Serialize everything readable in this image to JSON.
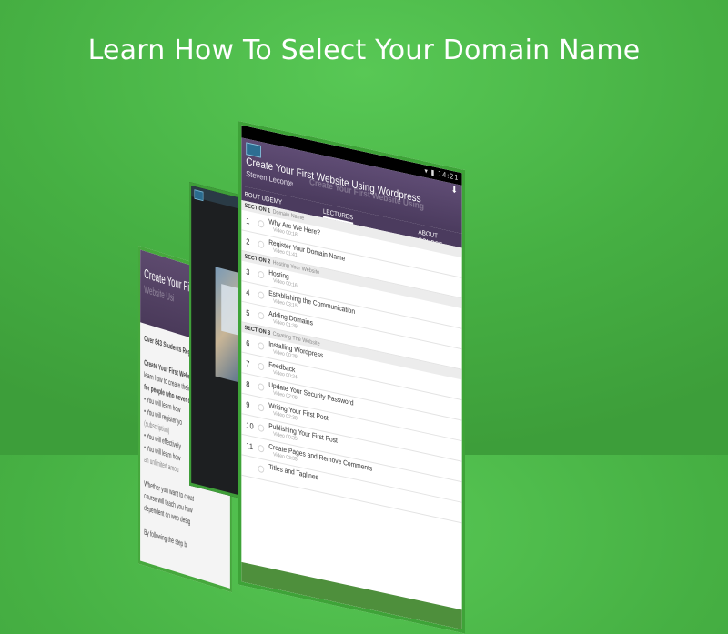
{
  "headline": "Learn How To Select Your Domain Name",
  "front": {
    "status_icons": "▾ ▮ 14:21",
    "download_icon": "download-icon",
    "title": "Create Your First Website Using Wordpress",
    "author": "Steven Leconte",
    "ghost_text": "Create Your First Website Using",
    "tabs": [
      "BOUT UDEMY",
      "LECTURES",
      "ABOUT COURSE"
    ],
    "sections": [
      {
        "label": "SECTION 1",
        "name": "Domain Name",
        "items": [
          {
            "num": "1",
            "title": "Why Are We Here?",
            "meta": "Video 00:18"
          },
          {
            "num": "2",
            "title": "Register Your Domain Name",
            "meta": "Video 01:41"
          }
        ]
      },
      {
        "label": "SECTION 2",
        "name": "Hosting Your Website",
        "items": [
          {
            "num": "3",
            "title": "Hosting",
            "meta": "Video 00:16"
          },
          {
            "num": "4",
            "title": "Establishing the Communication",
            "meta": "Video 03:15"
          },
          {
            "num": "5",
            "title": "Adding Domains",
            "meta": "Video 01:39"
          }
        ]
      },
      {
        "label": "SECTION 3",
        "name": "Creating The Website",
        "items": [
          {
            "num": "6",
            "title": "Installing Wordpress",
            "meta": "Video 00:39"
          },
          {
            "num": "7",
            "title": "Feedback",
            "meta": "Video 00:24"
          },
          {
            "num": "8",
            "title": "Update Your Security Password",
            "meta": "Video 02:09"
          },
          {
            "num": "9",
            "title": "Writing Your First Post",
            "meta": "Video 02:38"
          },
          {
            "num": "10",
            "title": "Publishing Your First Post",
            "meta": "Video 00:35"
          },
          {
            "num": "11",
            "title": "Create Pages and Remove Comments",
            "meta": "Video 03:35"
          },
          {
            "num": "",
            "title": "Titles and Taglines",
            "meta": ""
          }
        ]
      }
    ]
  },
  "back": {
    "title": "Create Your First",
    "subtitle": "Website Usi",
    "lines": [
      {
        "text": "Over 843 Students Registe",
        "style": "bold"
      },
      {
        "text": "",
        "style": ""
      },
      {
        "text": "Create Your First Website",
        "style": "bold"
      },
      {
        "text": "learn how to create their",
        "style": ""
      },
      {
        "text": "for people who never crea",
        "style": "bold"
      },
      {
        "text": "• You will learn how",
        "style": ""
      },
      {
        "text": "• You will register yo",
        "style": ""
      },
      {
        "text": "  (subscription)",
        "style": "dim"
      },
      {
        "text": "• You will effectively",
        "style": ""
      },
      {
        "text": "• You will learn how",
        "style": ""
      },
      {
        "text": "  an unlimited amou",
        "style": "dim"
      },
      {
        "text": "",
        "style": ""
      },
      {
        "text": "Whether you want to creat",
        "style": ""
      },
      {
        "text": "course will teach you how",
        "style": ""
      },
      {
        "text": "dependent on web desig",
        "style": ""
      },
      {
        "text": "",
        "style": ""
      },
      {
        "text": "By following the step b",
        "style": ""
      }
    ]
  }
}
